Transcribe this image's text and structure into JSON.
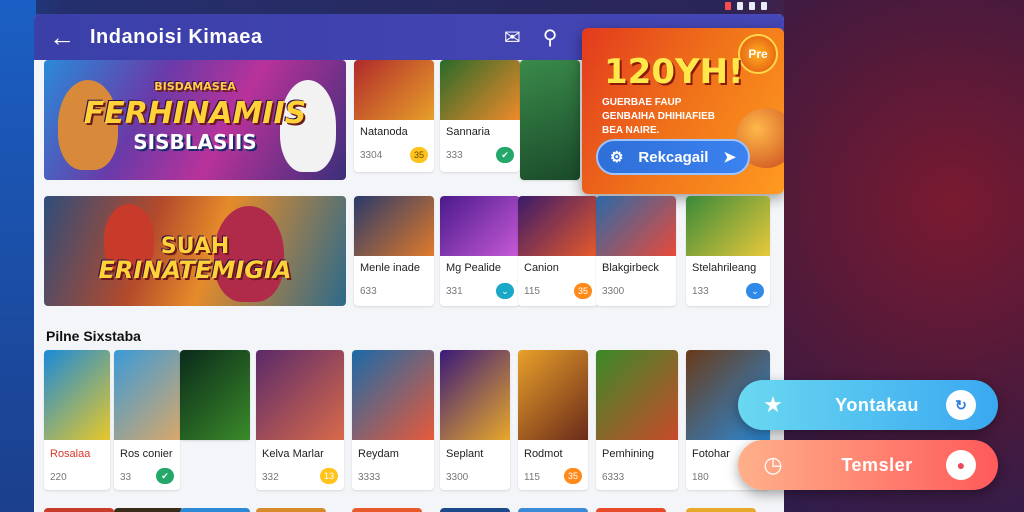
{
  "app": {
    "title": "Indanoisi Kimaea",
    "back_icon": "arrow-left-icon",
    "actions": [
      {
        "icon": "chat-bubble-icon"
      },
      {
        "icon": "search-icon"
      }
    ]
  },
  "banners": [
    {
      "kicker": "BISDAMASEA",
      "headline": "FERHINAMIIS",
      "tagline": "SISBLASIIS"
    },
    {
      "kicker": "SUAH",
      "headline": "ERINATEMIGIA"
    }
  ],
  "promo": {
    "title": "120YH!",
    "subtitle": "GUERBAE FAUP GENBAIHA DHIHIAFIEB BEA NAIRE.",
    "button_label": "Rekcagail",
    "badge": "Pre"
  },
  "top_cards": [
    {
      "name": "Natanoda",
      "count": "3304",
      "badge": "35",
      "badge_color": "y"
    },
    {
      "name": "Sannaria",
      "count": "333",
      "badge": "✔",
      "badge_color": "g"
    }
  ],
  "row_cards": [
    {
      "name": "Menle inade",
      "count": "633",
      "badge": ""
    },
    {
      "name": "Mg Pealide",
      "count": "331",
      "badge": "⌄",
      "badge_color": "t"
    },
    {
      "name": "Canion",
      "count": "115",
      "badge": "35",
      "badge_color": "o"
    },
    {
      "name": "Blakgirbeck",
      "count": "3300",
      "badge": ""
    },
    {
      "name": "Stelahrileang",
      "count": "133",
      "badge": "⌄",
      "badge_color": "b"
    }
  ],
  "section": {
    "label": "Pilne Sixstaba"
  },
  "grid_cards": [
    {
      "name": "Rosalaa",
      "count": "220",
      "badge": ""
    },
    {
      "name": "Ros conier",
      "count": "33",
      "badge": "✔",
      "badge_color": "g"
    },
    {
      "name": "",
      "count": "",
      "badge": ""
    },
    {
      "name": "Kelva Marlar",
      "count": "332",
      "badge": "13",
      "badge_color": "y"
    },
    {
      "name": "Reydam",
      "count": "3333",
      "badge": ""
    },
    {
      "name": "Seplant",
      "count": "3300",
      "badge": ""
    },
    {
      "name": "Rodmot",
      "count": "115",
      "badge": "35",
      "badge_color": "o"
    },
    {
      "name": "Pemhining",
      "count": "6333",
      "badge": ""
    },
    {
      "name": "Fotohar",
      "count": "180",
      "badge": ""
    }
  ],
  "fabs": [
    {
      "label": "Yontakau",
      "lead_icon": "star-icon",
      "trail_icon": "share-icon"
    },
    {
      "label": "Temsler",
      "lead_icon": "clock-icon",
      "trail_icon": "toggle-icon"
    }
  ]
}
